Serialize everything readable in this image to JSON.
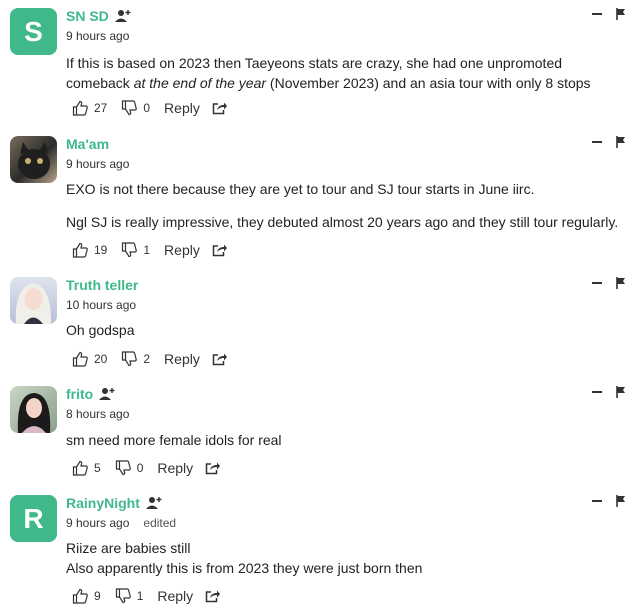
{
  "comments": [
    {
      "avatar_letter": "S",
      "avatar_color": "#3fb98a",
      "username": "SN SD",
      "time": "9 hours ago",
      "edited": "",
      "body_a": "If this is based on 2023 then Taeyeons stats are crazy, she had one unpromoted comeback ",
      "body_b": "at the end of the year",
      "body_c": " (November 2023) and an asia tour with only 8 stops",
      "upvotes": "27",
      "downvotes": "0",
      "reply_label": "Reply"
    },
    {
      "username": "Ma'am",
      "time": "9 hours ago",
      "body_p1": "EXO is not there because they are yet to tour and SJ tour starts in June iirc.",
      "body_p2": "Ngl SJ is really impressive, they debuted almost 20 years ago and they still tour regularly.",
      "upvotes": "19",
      "downvotes": "1",
      "reply_label": "Reply"
    },
    {
      "username": "Truth teller",
      "time": "10 hours ago",
      "body_p1": "Oh godspa",
      "upvotes": "20",
      "downvotes": "2",
      "reply_label": "Reply"
    },
    {
      "username": "frito",
      "time": "8 hours ago",
      "body_p1": "sm need more female idols for real",
      "upvotes": "5",
      "downvotes": "0",
      "reply_label": "Reply"
    },
    {
      "avatar_letter": "R",
      "avatar_color": "#3fb98a",
      "username": "RainyNight",
      "time": "9 hours ago",
      "edited": "edited",
      "body_p1": "Riize are babies still",
      "body_p2": "Also apparently this is from 2023 they were just born then",
      "upvotes": "9",
      "downvotes": "1",
      "reply_label": "Reply"
    }
  ]
}
